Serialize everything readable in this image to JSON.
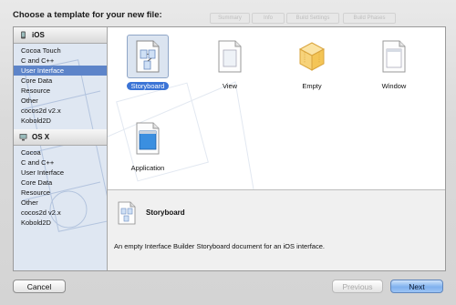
{
  "dialog": {
    "heading": "Choose a template for your new file:"
  },
  "background_tabs": [
    "Summary",
    "Info",
    "Build Settings",
    "Build Phases"
  ],
  "sidebar": {
    "sections": [
      {
        "title": "iOS",
        "items": [
          "Cocoa Touch",
          "C and C++",
          "User Interface",
          "Core Data",
          "Resource",
          "Other",
          "cocos2d v2.x",
          "Kobold2D"
        ],
        "selected_index": 2
      },
      {
        "title": "OS X",
        "items": [
          "Cocoa",
          "C and C++",
          "User Interface",
          "Core Data",
          "Resource",
          "Other",
          "cocos2d v2.x",
          "Kobold2D"
        ],
        "selected_index": -1
      }
    ]
  },
  "templates": [
    {
      "name": "Storyboard",
      "icon": "storyboard-icon",
      "selected": true
    },
    {
      "name": "View",
      "icon": "view-document-icon",
      "selected": false
    },
    {
      "name": "Empty",
      "icon": "empty-cube-icon",
      "selected": false
    },
    {
      "name": "Window",
      "icon": "window-document-icon",
      "selected": false
    },
    {
      "name": "Application",
      "icon": "application-document-icon",
      "selected": false
    }
  ],
  "details": {
    "title": "Storyboard",
    "description": "An empty Interface Builder Storyboard document for an iOS interface."
  },
  "buttons": {
    "cancel": "Cancel",
    "previous": "Previous",
    "next": "Next"
  },
  "colors": {
    "selection": "#5d84c9",
    "primary_button": "#7fb1ee"
  }
}
